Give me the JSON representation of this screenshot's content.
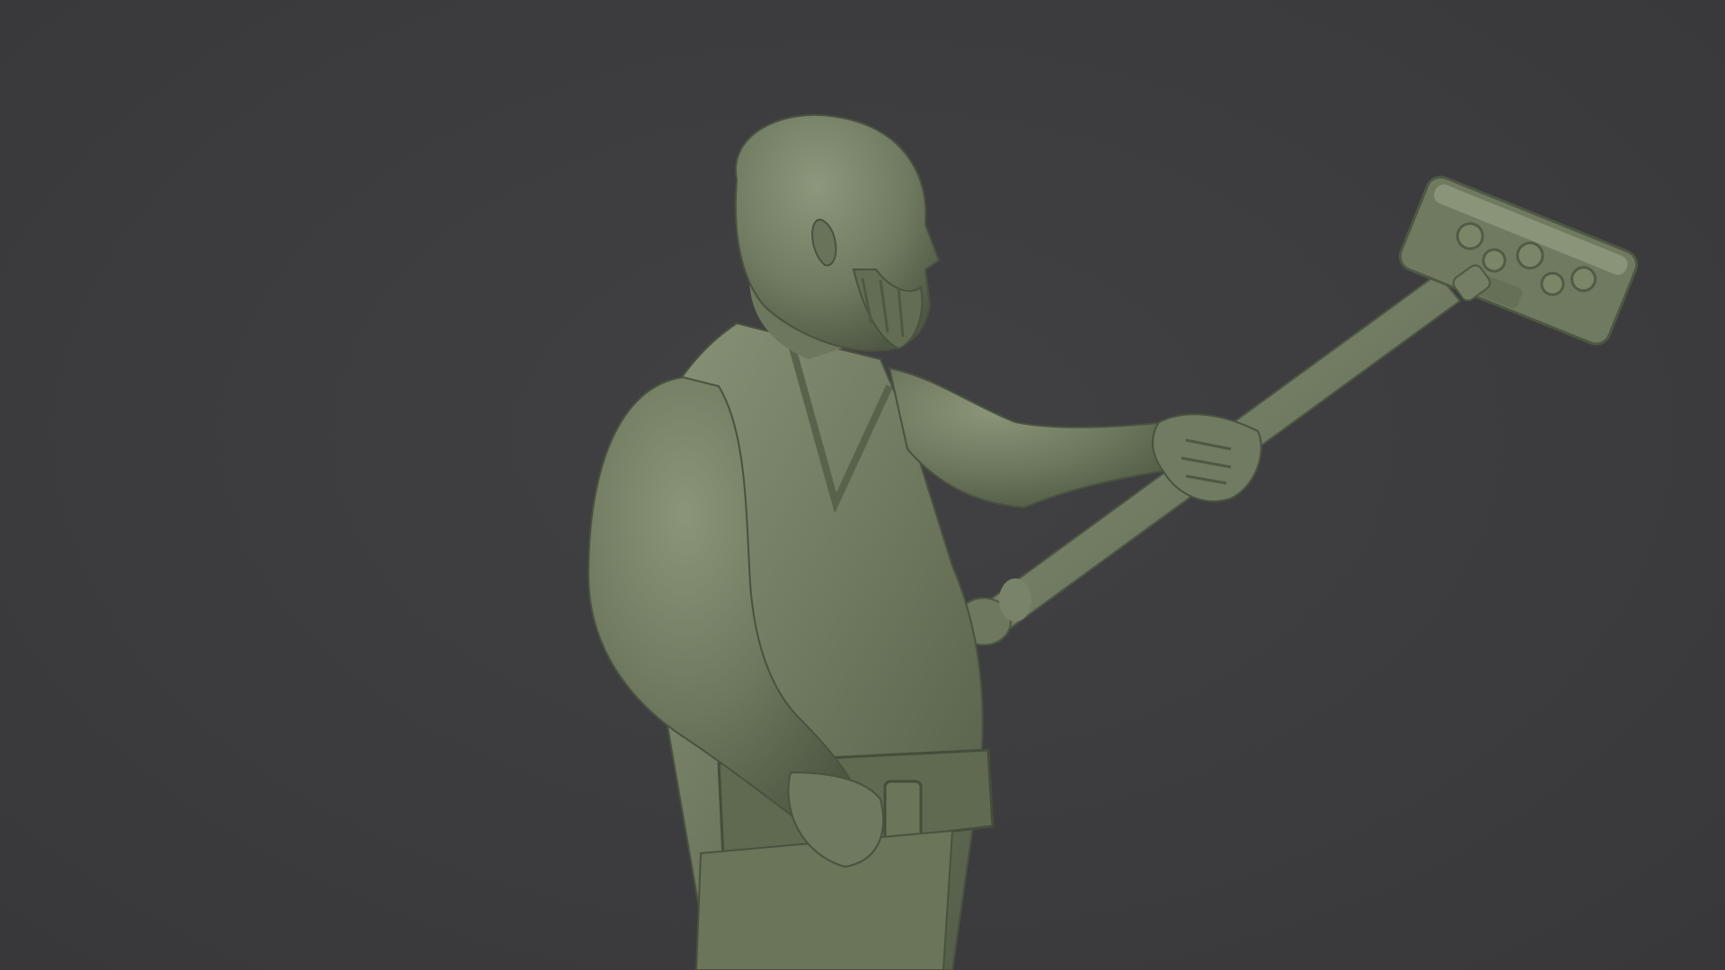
{
  "viewport": {
    "background_color": "#3d3d3f",
    "model_color": "#6f7a60",
    "model_highlight_color": "#8a9479",
    "model_shadow_color": "#4f5843"
  },
  "model": {
    "subject": "bald-bearded-man-holding-warhammer-sculpt"
  }
}
